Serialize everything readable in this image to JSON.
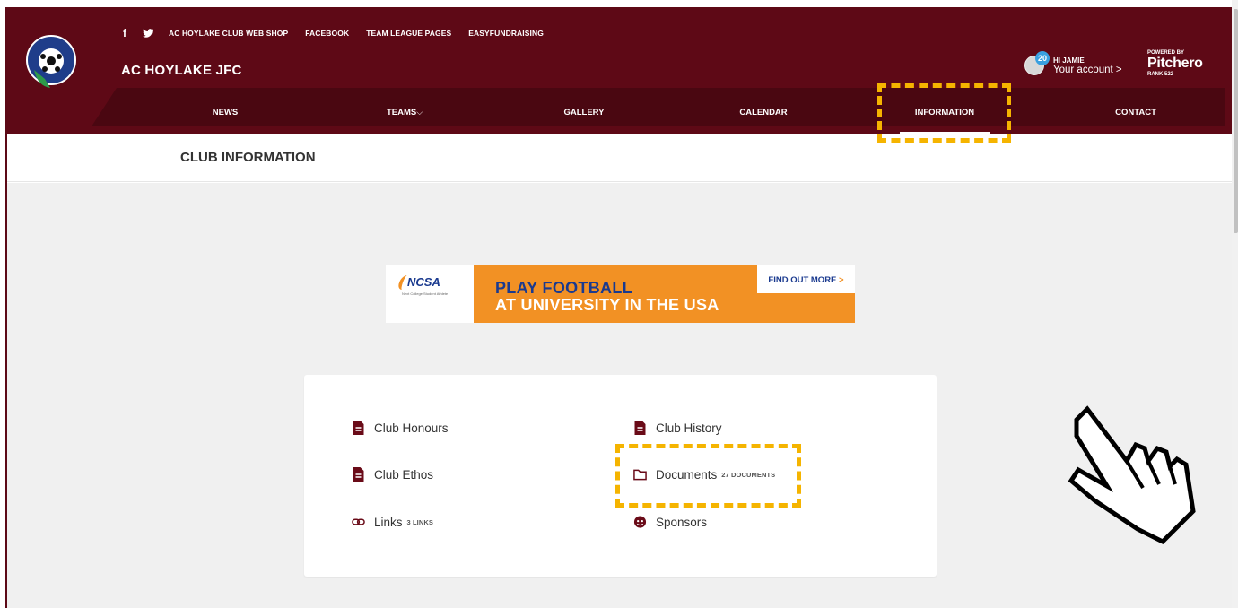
{
  "header": {
    "social": {
      "facebook_glyph": "f",
      "twitter_glyph": "🐦"
    },
    "top_links": [
      "AC HOYLAKE CLUB WEB SHOP",
      "FACEBOOK",
      "TEAM LEAGUE PAGES",
      "EASYFUNDRAISING"
    ],
    "club_name": "AC HOYLAKE JFC",
    "logo_text": "AC HOYLAKE J.F.C.",
    "account": {
      "badge": "20",
      "greeting": "HI JAMIE",
      "link": "Your account >"
    },
    "powered": {
      "label": "POWERED BY",
      "brand": "Pitchero",
      "rank": "RANK 522"
    }
  },
  "nav": {
    "items": [
      "NEWS",
      "TEAMS",
      "GALLERY",
      "CALENDAR",
      "INFORMATION",
      "CONTACT"
    ],
    "teams_chevron": "⌵",
    "active": "INFORMATION"
  },
  "subheader": {
    "title": "CLUB INFORMATION"
  },
  "ad": {
    "logo": "NCSA",
    "logo_sub": "Next College Student Athlete",
    "line1": "PLAY FOOTBALL",
    "line2": "AT UNIVERSITY IN THE USA",
    "cta": "FIND OUT MORE",
    "cta_arrow": ">"
  },
  "info": {
    "items": [
      {
        "label": "Club Honours",
        "icon": "document-icon"
      },
      {
        "label": "Club History",
        "icon": "document-icon"
      },
      {
        "label": "Club Ethos",
        "icon": "document-icon"
      },
      {
        "label": "Documents",
        "icon": "folder-icon",
        "count": "27 DOCUMENTS"
      },
      {
        "label": "Links",
        "icon": "link-icon",
        "count": "3 LINKS"
      },
      {
        "label": "Sponsors",
        "icon": "sponsor-icon"
      }
    ]
  },
  "colors": {
    "brand": "#5e0916",
    "nav": "#4a0711",
    "accent": "#f5b400",
    "ad_orange": "#f29124",
    "ad_blue": "#1a3a8f"
  }
}
